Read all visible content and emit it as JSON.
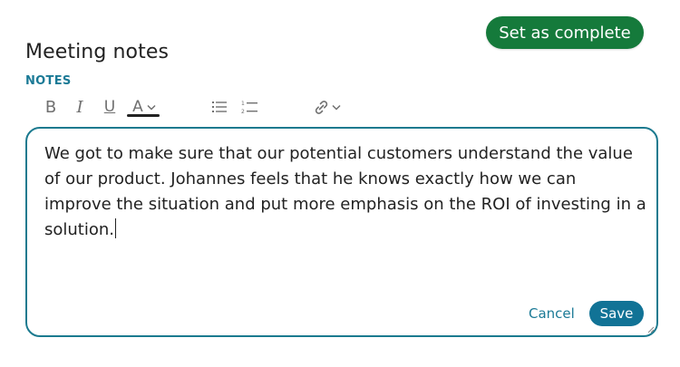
{
  "header": {
    "title": "Meeting notes",
    "complete_button": "Set as complete"
  },
  "notes": {
    "label": "NOTES",
    "content": "We got to make sure that our potential customers understand the value of our product. Johannes feels that he knows exactly how we can improve the situation and put more emphasis on the ROI of investing in a solution.",
    "cancel_label": "Cancel",
    "save_label": "Save"
  },
  "toolbar": {
    "bold": "B",
    "italic": "I",
    "underline": "U",
    "text_color": "A",
    "icons": [
      "bold-icon",
      "italic-icon",
      "underline-icon",
      "text-color-icon",
      "bulleted-list-icon",
      "numbered-list-icon",
      "link-icon"
    ]
  },
  "colors": {
    "complete_button": "#157a3b",
    "accent": "#1b7a96",
    "save_button": "#117396",
    "editor_border": "#1b7a8f"
  }
}
